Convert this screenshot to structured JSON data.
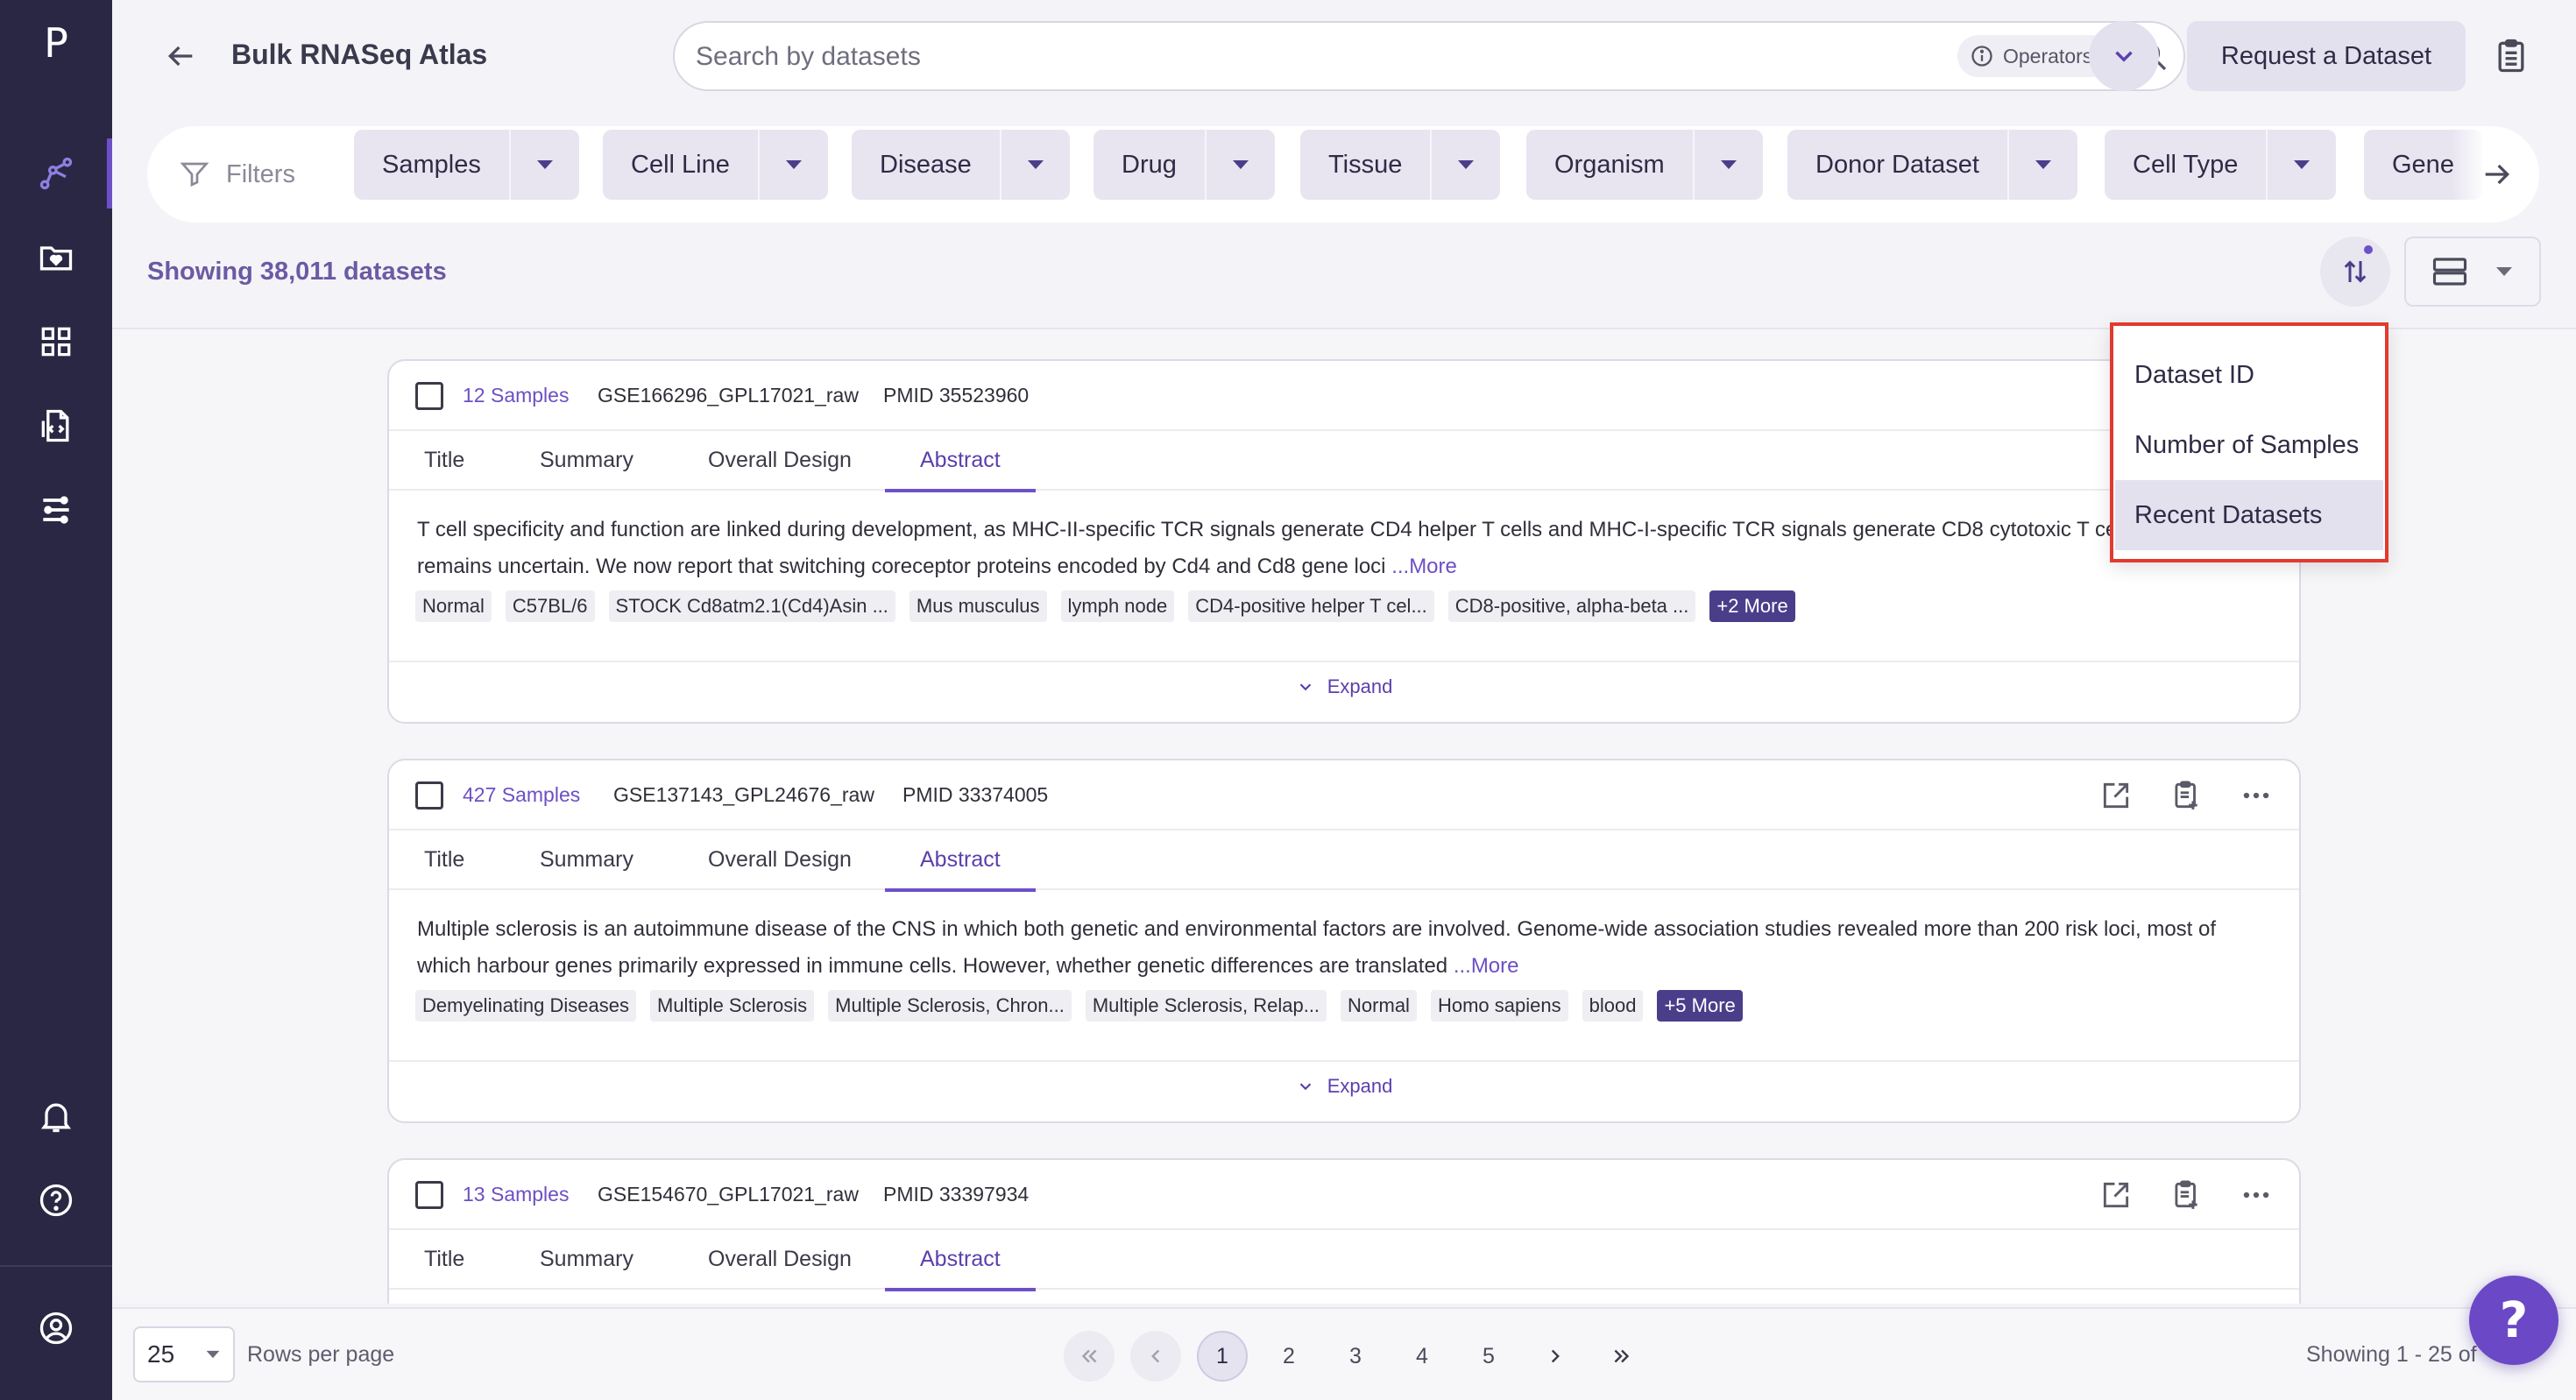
{
  "app": {
    "logo_letter": "P"
  },
  "header": {
    "title": "Bulk RNASeq Atlas",
    "search_placeholder": "Search by datasets",
    "operators_label": "Operators",
    "request_button": "Request a Dataset"
  },
  "filters": {
    "label": "Filters",
    "chips": [
      "Samples",
      "Cell Line",
      "Disease",
      "Drug",
      "Tissue",
      "Organism",
      "Donor Dataset",
      "Cell Type",
      "Gene"
    ]
  },
  "results": {
    "showing_text": "Showing 38,011 datasets"
  },
  "sort_menu": {
    "options": [
      "Dataset ID",
      "Number of Samples",
      "Recent Datasets"
    ],
    "selected": "Recent Datasets"
  },
  "tab_labels": [
    "Title",
    "Summary",
    "Overall Design",
    "Abstract"
  ],
  "expand_label": "Expand",
  "datasets": [
    {
      "samples": "12 Samples",
      "id": "GSE166296_GPL17021_raw",
      "pmid": "PMID 35523960",
      "abstract": "T cell specificity and function are linked during development, as MHC-II-specific TCR signals generate CD4 helper T cells and MHC-I-specific TCR signals generate CD8 cytotoxic T cells, but the basis remains uncertain. We now report that switching coreceptor proteins encoded by Cd4 and Cd8 gene loci",
      "more": "...More",
      "tags": [
        "Normal",
        "C57BL/6",
        "STOCK Cd8atm2.1(Cd4)Asin ...",
        "Mus musculus",
        "lymph node",
        "CD4-positive helper T cel...",
        "CD8-positive, alpha-beta ..."
      ],
      "more_tags": "+2 More"
    },
    {
      "samples": "427 Samples",
      "id": "GSE137143_GPL24676_raw",
      "pmid": "PMID 33374005",
      "abstract": "Multiple sclerosis is an autoimmune disease of the CNS in which both genetic and environmental factors are involved. Genome-wide association studies revealed more than 200 risk loci, most of which harbour genes primarily expressed in immune cells. However, whether genetic differences are translated",
      "more": "...More",
      "tags": [
        "Demyelinating Diseases",
        "Multiple Sclerosis",
        "Multiple Sclerosis, Chron...",
        "Multiple Sclerosis, Relap...",
        "Normal",
        "Homo sapiens",
        "blood"
      ],
      "more_tags": "+5 More"
    },
    {
      "samples": "13 Samples",
      "id": "GSE154670_GPL17021_raw",
      "pmid": "PMID 33397934"
    }
  ],
  "pagination": {
    "rows_per_page_value": "25",
    "rows_per_page_label": "Rows per page",
    "pages": [
      "1",
      "2",
      "3",
      "4",
      "5"
    ],
    "current_page": "1",
    "showing_range": "Showing 1 - 25 of"
  },
  "help_fab": "?",
  "colors": {
    "sidebar_bg": "#2a2744",
    "accent": "#6d50c8",
    "chip_bg": "#e8e5f1",
    "highlight_border": "#e23a2e"
  }
}
